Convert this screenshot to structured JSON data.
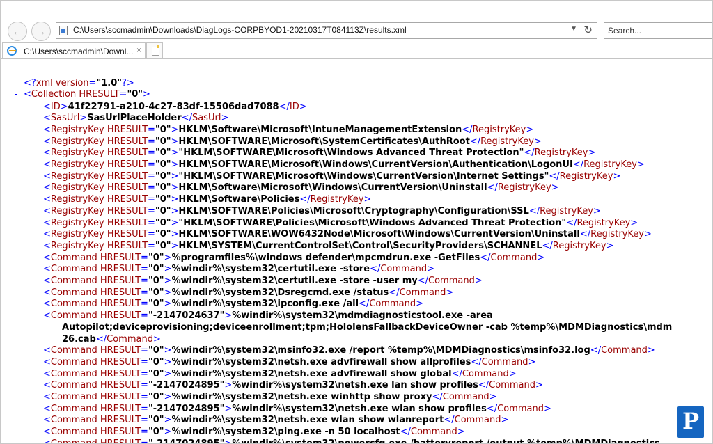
{
  "browser": {
    "address": "C:\\Users\\sccmadmin\\Downloads\\DiagLogs-CORPBYOD1-20210317T084113Z\\results.xml",
    "search_placeholder": "Search...",
    "tab_title": "C:\\Users\\sccmadmin\\Downl...",
    "tab_close": "×",
    "back_icon": "back-arrow-icon",
    "forward_icon": "forward-arrow-icon",
    "refresh_icon": "refresh-icon",
    "dropdown_icon": "chevron-down-icon",
    "colors": {
      "tag": "#990000",
      "bracket": "#0000ff",
      "text": "#000000",
      "attr_value": "#000000"
    }
  },
  "xml": {
    "declaration": "<?xml version=\"1.0\"?>",
    "collection_open": "<Collection HRESULT=\"0\">",
    "collapse_marker": "-",
    "lines": [
      {
        "open": "<ID>",
        "text": "41f22791-a210-4c27-83df-15506dad7088",
        "close": "</ID>"
      },
      {
        "open": "<SasUrl>",
        "text": "SasUrlPlaceHolder",
        "close": "</SasUrl>"
      },
      {
        "open": "<RegistryKey HRESULT=\"0\">",
        "text": "HKLM\\Software\\Microsoft\\IntuneManagementExtension",
        "close": "</RegistryKey>"
      },
      {
        "open": "<RegistryKey HRESULT=\"0\">",
        "text": "HKLM\\SOFTWARE\\Microsoft\\SystemCertificates\\AuthRoot",
        "close": "</RegistryKey>"
      },
      {
        "open": "<RegistryKey HRESULT=\"0\">",
        "text": "\"HKLM\\SOFTWARE\\Microsoft\\Windows Advanced Threat Protection\"",
        "close": "</RegistryKey>"
      },
      {
        "open": "<RegistryKey HRESULT=\"0\">",
        "text": "HKLM\\SOFTWARE\\Microsoft\\Windows\\CurrentVersion\\Authentication\\LogonUI",
        "close": "</RegistryKey>"
      },
      {
        "open": "<RegistryKey HRESULT=\"0\">",
        "text": "\"HKLM\\SOFTWARE\\Microsoft\\Windows\\CurrentVersion\\Internet Settings\"",
        "close": "</RegistryKey>"
      },
      {
        "open": "<RegistryKey HRESULT=\"0\">",
        "text": "HKLM\\Software\\Microsoft\\Windows\\CurrentVersion\\Uninstall",
        "close": "</RegistryKey>"
      },
      {
        "open": "<RegistryKey HRESULT=\"0\">",
        "text": "HKLM\\Software\\Policies",
        "close": "</RegistryKey>"
      },
      {
        "open": "<RegistryKey HRESULT=\"0\">",
        "text": "HKLM\\SOFTWARE\\Policies\\Microsoft\\Cryptography\\Configuration\\SSL",
        "close": "</RegistryKey>"
      },
      {
        "open": "<RegistryKey HRESULT=\"0\">",
        "text": "\"HKLM\\SOFTWARE\\Policies\\Microsoft\\Windows Advanced Threat Protection\"",
        "close": "</RegistryKey>"
      },
      {
        "open": "<RegistryKey HRESULT=\"0\">",
        "text": "HKLM\\SOFTWARE\\WOW6432Node\\Microsoft\\Windows\\CurrentVersion\\Uninstall",
        "close": "</RegistryKey>"
      },
      {
        "open": "<RegistryKey HRESULT=\"0\">",
        "text": "HKLM\\SYSTEM\\CurrentControlSet\\Control\\SecurityProviders\\SCHANNEL",
        "close": "</RegistryKey>"
      },
      {
        "open": "<Command HRESULT=\"0\">",
        "text": "%programfiles%\\windows defender\\mpcmdrun.exe -GetFiles",
        "close": "</Command>"
      },
      {
        "open": "<Command HRESULT=\"0\">",
        "text": "%windir%\\system32\\certutil.exe -store",
        "close": "</Command>"
      },
      {
        "open": "<Command HRESULT=\"0\">",
        "text": "%windir%\\system32\\certutil.exe -store -user my",
        "close": "</Command>"
      },
      {
        "open": "<Command HRESULT=\"0\">",
        "text": "%windir%\\system32\\Dsregcmd.exe /status",
        "close": "</Command>"
      },
      {
        "open": "<Command HRESULT=\"0\">",
        "text": "%windir%\\system32\\ipconfig.exe /all",
        "close": "</Command>"
      },
      {
        "open": "<Command HRESULT=\"-2147024637\">",
        "text": "%windir%\\system32\\mdmdiagnosticstool.exe -area",
        "close": ""
      },
      {
        "open": "",
        "text": "Autopilot;deviceprovisioning;deviceenrollment;tpm;HololensFallbackDeviceOwner -cab %temp%\\MDMDiagnostics\\mdm",
        "close": "",
        "cont": true
      },
      {
        "open": "",
        "text": "26.cab",
        "close": "</Command>",
        "cont": true
      },
      {
        "open": "<Command HRESULT=\"0\">",
        "text": "%windir%\\system32\\msinfo32.exe /report %temp%\\MDMDiagnostics\\msinfo32.log",
        "close": "</Command>"
      },
      {
        "open": "<Command HRESULT=\"0\">",
        "text": "%windir%\\system32\\netsh.exe advfirewall show allprofiles",
        "close": "</Command>"
      },
      {
        "open": "<Command HRESULT=\"0\">",
        "text": "%windir%\\system32\\netsh.exe advfirewall show global",
        "close": "</Command>"
      },
      {
        "open": "<Command HRESULT=\"-2147024895\">",
        "text": "%windir%\\system32\\netsh.exe lan show profiles",
        "close": "</Command>"
      },
      {
        "open": "<Command HRESULT=\"0\">",
        "text": "%windir%\\system32\\netsh.exe winhttp show proxy",
        "close": "</Command>"
      },
      {
        "open": "<Command HRESULT=\"-2147024895\">",
        "text": "%windir%\\system32\\netsh.exe wlan show profiles",
        "close": "</Command>"
      },
      {
        "open": "<Command HRESULT=\"0\">",
        "text": "%windir%\\system32\\netsh.exe wlan show wlanreport",
        "close": "</Command>"
      },
      {
        "open": "<Command HRESULT=\"0\">",
        "text": "%windir%\\system32\\ping.exe -n 50 localhost",
        "close": "</Command>"
      },
      {
        "open": "<Command HRESULT=\"-2147024895\">",
        "text": "%windir%\\system32\\powercfg.exe /batteryreport /output %temp%\\MDMDiagnostics",
        "close": ""
      }
    ]
  },
  "watermark": {
    "letter": "P",
    "icon": "prajwal-logo-icon"
  }
}
